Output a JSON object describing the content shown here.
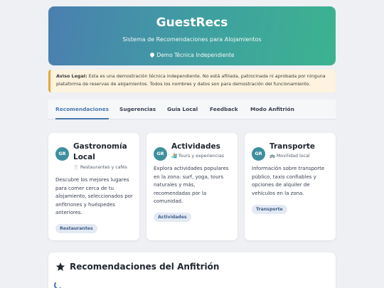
{
  "header": {
    "title": "GuestRecs",
    "subtitle": "Sistema de Recomendaciones para Alojamientos",
    "badge": "Demo Técnica Independiente"
  },
  "legal": {
    "label": "Aviso Legal:",
    "text": " Esta es una demostración técnica independiente. No está afiliada, patrocinada ni aprobada por ninguna plataforma de reservas de alojamientos. Todos los nombres y datos son para demostración del funcionamiento."
  },
  "tabs": [
    {
      "label": "Recomendaciones",
      "active": true
    },
    {
      "label": "Sugerencias"
    },
    {
      "label": "Guía Local"
    },
    {
      "label": "Feedback"
    },
    {
      "label": "Modo Anfitrión"
    }
  ],
  "cards": [
    {
      "avatar": "GR",
      "title": "Gastronomía Local",
      "icon": "utensils-icon",
      "subtitle": "Restaurantes y cafés",
      "description": "Descubre los mejores lugares para comer cerca de tu alojamiento, seleccionados por anfitriones y huéspedes anteriores.",
      "tag": "Restaurantes"
    },
    {
      "avatar": "GR",
      "title": "Actividades",
      "icon": "surf-icon",
      "subtitle": "Tours y experiencias",
      "description": "Explora actividades populares en la zona: surf, yoga, tours naturales y más, recomendadas por la comunidad.",
      "tag": "Actividades"
    },
    {
      "avatar": "GR",
      "title": "Transporte",
      "icon": "bus-icon",
      "subtitle": "Movilidad local",
      "description": "Información sobre transporte público, taxis confiables y opciones de alquiler de vehículos en la zona.",
      "tag": "Transporte"
    }
  ],
  "section": {
    "icon": "star-icon",
    "title": "Recomendaciones del Anfitrión"
  },
  "colors": {
    "accent": "#4a78b0",
    "header_start": "#4a7fb0",
    "header_end": "#3cb38f",
    "avatar": "#3d8f9e",
    "warning_border": "#e2a93b"
  }
}
